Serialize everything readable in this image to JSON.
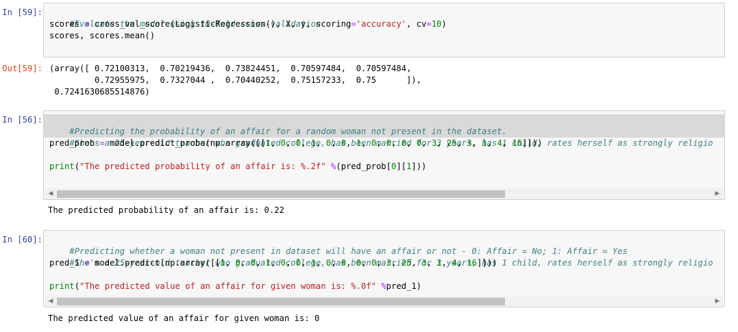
{
  "cells": {
    "c59": {
      "prompt": "In [59]:",
      "lines": [
        "#Evaluate the model using 10-fold cross-validation",
        "scores = cross_val_score(LogisticRegression(), X, y, scoring='accuracy', cv=10)",
        "scores, scores.mean()"
      ],
      "out_prompt": "Out[59]:",
      "output": [
        "(array([ 0.72100313,  0.70219436,  0.73824451,  0.70597484,  0.70597484,",
        "         0.72955975,  0.7327044 ,  0.70440252,  0.75157233,  0.75      ]),",
        " 0.7241630685514876)"
      ]
    },
    "c56": {
      "prompt": "In [56]:",
      "lines": [
        "#Predicting the probability of an affair for a random woman not present in the dataset.",
        "#She's a 25-year-old teacher who graduated college, has been married for 3 years, has 1 child, rates herself as strongly religio",
        "pred_prob = model.predict_proba(np.array([[1, 0, 0, 1, 0, 0, 1, 0, 0, 0, 0, 3, 25, 3, 1, 4, 16]]))",
        "",
        "print(\"The predicted probability of an affair is: %.2f\" %(pred_prob[0][1]))"
      ],
      "output": [
        "The predicted probability of an affair is: 0.22"
      ]
    },
    "c60": {
      "prompt": "In [60]:",
      "lines": [
        "#Predicting whether a woman not present in dataset will have an affair or not - 0: Affair = No; 1: Affair = Yes",
        "#She's a 25-year-old teacher who graduated college, has been married for 3 years, has 1 child, rates herself as strongly religio",
        "pred_1 = model.predict(np.array([[1, 0, 0, 1, 0, 0, 1, 0, 0, 0, 0, 3, 25, 3, 1, 4, 16]]))",
        "",
        "print(\"The predicted value of an affair for given woman is: %.0f\" %pred_1)"
      ],
      "output": [
        "The predicted value of an affair for given woman is: 0"
      ]
    }
  },
  "scrollbar": {
    "left_arrow": "◀",
    "right_arrow": "▶",
    "thumb_fraction": 0.67
  },
  "colors": {
    "in_prompt": "#303f9f",
    "out_prompt": "#d84315",
    "comment": "#408080",
    "string": "#ba2121",
    "number": "#008000",
    "operator": "#aa22ff",
    "cell_background": "#f7f7f7"
  }
}
